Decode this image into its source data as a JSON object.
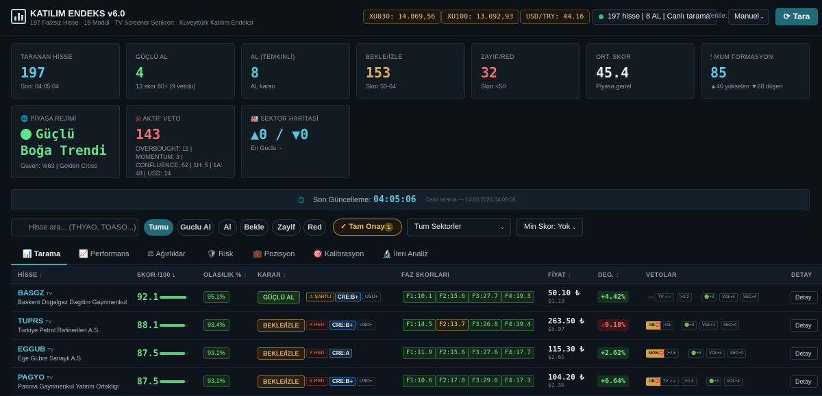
{
  "app": {
    "title": "KATILIM ENDEKS v6.0",
    "subtitle": "197 Faizsiz Hisse · 18 Modül · TV Screener Senkron · Kuveyttürk Katılım Endeksi"
  },
  "ticker": {
    "xu030": "XU030: 14.869,56",
    "xu100": "XU100: 13.092,93",
    "usdtry": "USD/TRY: 44.16"
  },
  "status": "197 hisse | 8 AL | Canlı tarama",
  "refresh": {
    "label": "Yenile:",
    "value": "Manuel",
    "button": "Tara"
  },
  "colors": {
    "accent": "#1f6b78",
    "green": "#5fe38c",
    "amber": "#e0b35e",
    "red": "#f07070"
  },
  "cards": [
    {
      "label": "TARANAN HİSSE",
      "value": "197",
      "sub": "Son: 04:05:04",
      "color": "#5cc8e0"
    },
    {
      "label": "GÜÇLÜ AL",
      "value": "4",
      "sub": "13 skor 80+ (9 vetolu)",
      "color": "#5fe38c"
    },
    {
      "label": "AL (TEMKİNLİ)",
      "value": "8",
      "sub": "AL kararı",
      "color": "#5cc8e0"
    },
    {
      "label": "BEKLE/İZLE",
      "value": "153",
      "sub": "Skor 50-64",
      "color": "#e0b35e"
    },
    {
      "label": "ZAYIF/RED",
      "value": "32",
      "sub": "Skor <50",
      "color": "#f07070"
    },
    {
      "label": "ORT. SKOR",
      "value": "45.4",
      "sub": "Piyasa genel",
      "color": "#e6edf2"
    },
    {
      "label": "MUM FORMASYON",
      "value": "85",
      "sub": "▲46 yükselen ▼68 düşen",
      "color": "#5cc8e0",
      "icon": "🕯"
    }
  ],
  "regime": {
    "label": "PİYASA REJİMİ",
    "line1": "Güçlü",
    "line2": "Boğa Trendi",
    "sub": "Guven: %63 | Golden Cross"
  },
  "veto": {
    "label": "AKTİF VETO",
    "value": "143",
    "sub": "OVERBOUGHT: 11 | MOMENTUM: 3 | CONFLUENCE: 62 | 1H: 5 | 1A: 48 | USD: 14"
  },
  "sector": {
    "label": "SEKTOR HARİTASİ",
    "value": "▲0 / ▼0",
    "sub": "En Guclu: -"
  },
  "update": {
    "label": "Son Güncelleme:",
    "time": "04:05:06",
    "note": "Canlı tarama — 14.03.2026 04:05:06"
  },
  "search_placeholder": "Hisse ara... (THYAO, TOASO...)",
  "filters": [
    "Tumu",
    "Guclu Al",
    "Al",
    "Bekle",
    "Zayif",
    "Red"
  ],
  "onay": {
    "label": "✓ Tam Onay",
    "count": "1"
  },
  "sector_select": "Tum Sektorler",
  "min_score": "Min Skor: Yok",
  "tabs": [
    "Tarama",
    "Performans",
    "Ağırlıklar",
    "Risk",
    "Pozisyon",
    "Kalibrasyon",
    "İleri Analiz"
  ],
  "columns": [
    "HİSSE",
    "SKOR /100",
    "OLASILIK %",
    "KARAR",
    "FAZ SKORLARI",
    "FİYAT",
    "DEG.",
    "VETOLAR",
    "DETAY"
  ],
  "rows": [
    {
      "ticker": "BASGZ",
      "tv": "TV",
      "name": "Baskent Dogalgaz Dagitim Gayrimenkul",
      "score": "92.1",
      "score_pct": 92.1,
      "prob": "95.1%",
      "decision": "GÜÇLÜ AL",
      "dclass": "g",
      "tags": [
        {
          "t": "⚠ ŞARTLI",
          "c": "s"
        },
        {
          "t": "CRE:B+",
          "c": "c"
        },
        {
          "t": "USD+",
          "c": "u"
        }
      ],
      "phases": [
        {
          "t": "F1:10.1",
          "c": ""
        },
        {
          "t": "F2:15.6",
          "c": ""
        },
        {
          "t": "F3:27.7",
          "c": ""
        },
        {
          "t": "F4:19.3",
          "c": ""
        }
      ],
      "price": "50.10 ₺",
      "usd": "$1.13",
      "chg": "+4.42%",
      "chgc": "p",
      "vetos": [
        "—",
        "TV ✓✓",
        "🕯+3.2",
        "🟢+3",
        "VOL+4",
        "SEC+4"
      ],
      "detail": "Detay"
    },
    {
      "ticker": "TUPRS",
      "tv": "TV",
      "name": "Turkiye Petrol Rafinerileri A.S.",
      "score": "88.1",
      "score_pct": 88.1,
      "prob": "93.4%",
      "decision": "BEKLE/İZLE",
      "dclass": "b",
      "tags": [
        {
          "t": "✕ RED",
          "c": "r"
        },
        {
          "t": "CRE:B+",
          "c": "c"
        },
        {
          "t": "USD+",
          "c": "u"
        }
      ],
      "phases": [
        {
          "t": "F1:14.5",
          "c": ""
        },
        {
          "t": "F2:13.7",
          "c": "y"
        },
        {
          "t": "F3:26.8",
          "c": ""
        },
        {
          "t": "F4:19.4",
          "c": ""
        }
      ],
      "price": "263.50 ₺",
      "usd": "$5.97",
      "chg": "-0.18%",
      "chgc": "n",
      "vetos": [
        "OB⛔",
        "🕯+11",
        "🟢+3",
        "VOL+1",
        "SEC+4"
      ],
      "detail": "Detay"
    },
    {
      "ticker": "EGGUB",
      "tv": "TV",
      "name": "Ege Gubre Sanayii A.S.",
      "score": "87.5",
      "score_pct": 87.5,
      "prob": "93.1%",
      "decision": "BEKLE/İZLE",
      "dclass": "b",
      "tags": [
        {
          "t": "✕ RED",
          "c": "r"
        },
        {
          "t": "CRE:A",
          "c": "c"
        }
      ],
      "phases": [
        {
          "t": "F1:11.9",
          "c": ""
        },
        {
          "t": "F2:15.6",
          "c": ""
        },
        {
          "t": "F3:27.6",
          "c": ""
        },
        {
          "t": "F4:17.7",
          "c": ""
        }
      ],
      "price": "115.30 ₺",
      "usd": "$2.61",
      "chg": "+2.62%",
      "chgc": "p",
      "vetos": [
        "MOM⛔",
        "🕯+2.6",
        "🟢+3",
        "VOL+4",
        "SEC+2"
      ],
      "detail": "Detay"
    },
    {
      "ticker": "PAGYO",
      "tv": "TV",
      "name": "Panora Gayrimenkul Yatirim Ortakligi",
      "score": "87.5",
      "score_pct": 87.5,
      "prob": "93.1%",
      "decision": "BEKLE/İZLE",
      "dclass": "b",
      "tags": [
        {
          "t": "✕ RED",
          "c": "r"
        },
        {
          "t": "CRE:B+",
          "c": "c"
        },
        {
          "t": "USD+",
          "c": "u"
        }
      ],
      "phases": [
        {
          "t": "F1:10.6",
          "c": ""
        },
        {
          "t": "F2:17.0",
          "c": ""
        },
        {
          "t": "F3:29.6",
          "c": ""
        },
        {
          "t": "F4:17.3",
          "c": ""
        }
      ],
      "price": "104.20 ₺",
      "usd": "$2.36",
      "chg": "+6.64%",
      "chgc": "p",
      "vetos": [
        "OB⛔",
        "TV ✓✓",
        "🕯+1.3",
        "🟢+3",
        "VOL+4"
      ],
      "detail": "Detay"
    }
  ]
}
